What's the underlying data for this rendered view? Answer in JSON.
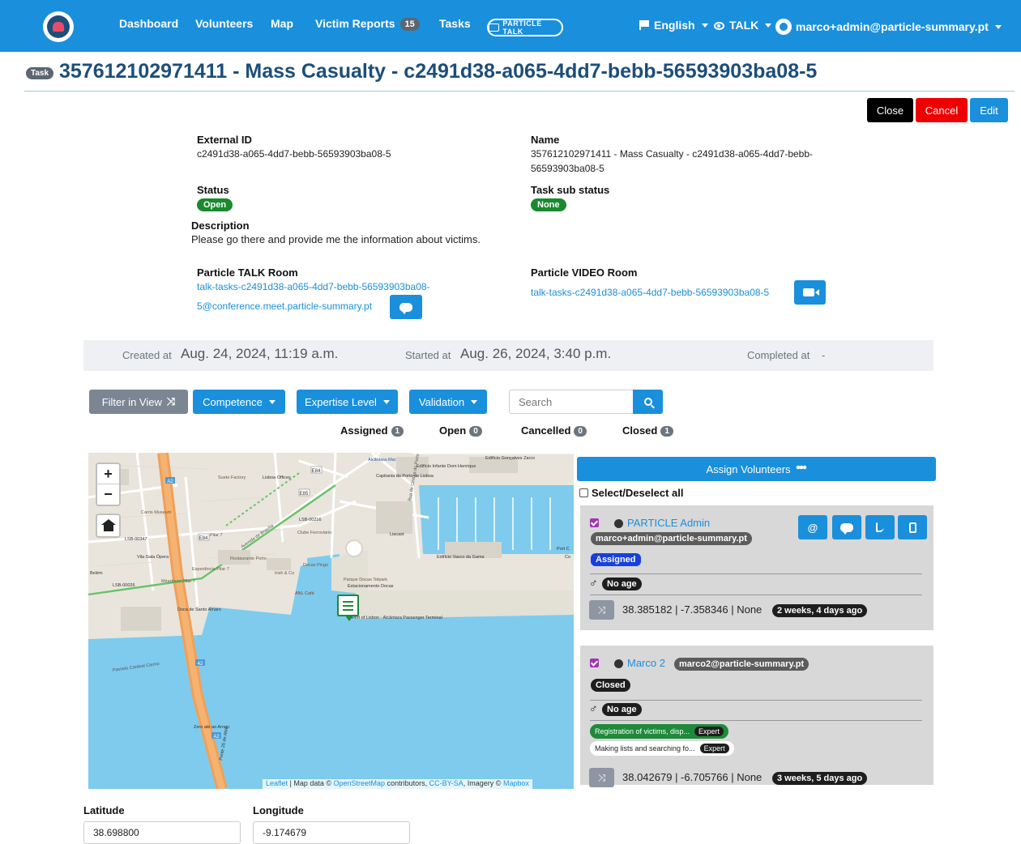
{
  "nav": {
    "items": [
      "Dashboard",
      "Volunteers",
      "Map",
      "Victim Reports",
      "Tasks"
    ],
    "victim_reports_count": "15",
    "brand_logo_text": "PARTICLE TALK",
    "language": "English",
    "talk": "TALK",
    "user_email": "marco+admin@particle-summary.pt"
  },
  "title": {
    "tag": "Task",
    "text": "357612102971411 - Mass Casualty - c2491d38-a065-4dd7-bebb-56593903ba08-5"
  },
  "actions": {
    "close": "Close",
    "cancel": "Cancel",
    "edit": "Edit"
  },
  "details": {
    "external_id_label": "External ID",
    "external_id": "c2491d38-a065-4dd7-bebb-56593903ba08-5",
    "name_label": "Name",
    "name_line1": "357612102971411 - Mass Casualty - c2491d38-a065-4dd7-bebb-",
    "name_line2": "56593903ba08-5",
    "status_label": "Status",
    "status": "Open",
    "substatus_label": "Task sub status",
    "substatus": "None",
    "description_label": "Description",
    "description": "Please go there and provide me the information about victims.",
    "talk_room_label": "Particle TALK Room",
    "talk_room_line1": "talk-tasks-c2491d38-a065-4dd7-bebb-56593903ba08-",
    "talk_room_line2": "5@conference.meet.particle-summary.pt",
    "video_room_label": "Particle VIDEO Room",
    "video_room": "talk-tasks-c2491d38-a065-4dd7-bebb-56593903ba08-5"
  },
  "dates": {
    "created_label": "Created at",
    "created": "Aug. 24, 2024, 11:19 a.m.",
    "started_label": "Started at",
    "started": "Aug. 26, 2024, 3:40 p.m.",
    "completed_label": "Completed at",
    "completed": "-"
  },
  "filters": {
    "filter_in_view": "Filter in View",
    "competence": "Competence",
    "expertise": "Expertise Level",
    "validation": "Validation",
    "search_placeholder": "Search"
  },
  "counts": {
    "assigned_label": "Assigned",
    "assigned": "1",
    "open_label": "Open",
    "open": "0",
    "cancelled_label": "Cancelled",
    "cancelled": "0",
    "closed_label": "Closed",
    "closed": "1"
  },
  "map": {
    "zoom_in": "+",
    "zoom_out": "−",
    "attribution_leaflet": "Leaflet",
    "attribution_mid": " | Map data © ",
    "attribution_osm": "OpenStreetMap",
    "attribution_contrib": " contributors, ",
    "attribution_cc": "CC-BY-SA",
    "attribution_imagery": ", Imagery © ",
    "attribution_mapbox": "Mapbox",
    "labels": [
      "Avenida de Brasília",
      "Clube Ferroviário",
      "Restaurante Porto",
      "Rua de Cintura do Porto de Lisboa",
      "Parque Docas Telpark",
      "Estacionamento Docas",
      "Edifício Vasco da Gama",
      "Port of Lisbon - Alcântara Passenger Terminal",
      "Passeio Cardeal Carmo",
      "Doca de Santo Amaro",
      "Pilar 7",
      "Experiência Pilar 7",
      "ANL Café",
      "Alcântara-Mar",
      "Ponte 25 de Abril",
      "Suete Factory",
      "Lisboa Offices",
      "Capitania do Porto de Lisboa",
      "Edifício Infante Dom Henrique",
      "Edifício Gonçalves Zarco",
      "Liacast",
      "Carris Museum",
      "LSB-00026",
      "LSB-00347",
      "LSB-00216",
      "Vila Gala Ópera",
      "Belém",
      "Irish & Co",
      "Docas Pingo",
      "Miradouro Pilar 7",
      "Zero até ao Arrojo",
      "Port C",
      "Co"
    ],
    "badges": [
      "E84",
      "E85",
      "E84",
      "42",
      "A2",
      "A2"
    ]
  },
  "panel": {
    "assign_label": "Assign Volunteers",
    "select_all": "Select/Deselect all",
    "volunteers": [
      {
        "name": "PARTICLE Admin",
        "email": "marco+admin@particle-summary.pt",
        "status": "Assigned",
        "gender_symbol": "♂",
        "age": "No age",
        "location": "38.385182 | -7.358346 | None",
        "ago": "2 weeks, 4 days ago"
      },
      {
        "name": "Marco 2",
        "email": "marco2@particle-summary.pt",
        "status": "Closed",
        "gender_symbol": "♂",
        "age": "No age",
        "competence1": "Registration of victims, disp...",
        "competence1_level": "Expert",
        "competence2": "Making lists and searching fo...",
        "competence2_level": "Expert",
        "location": "38.042679 | -6.705766 | None",
        "ago": "3 weeks, 5 days ago"
      }
    ],
    "contact_email_symbol": "@"
  },
  "coords": {
    "lat_label": "Latitude",
    "lat": "38.698800",
    "lng_label": "Longitude",
    "lng": "-9.174679"
  },
  "colors": {
    "navbar": "#1a8fdc",
    "title": "#1d4e7a",
    "open_badge": "#198a2e",
    "cancel": "#ee0000",
    "close": "#000000",
    "water": "#7ecbee",
    "road": "#f0a05a"
  }
}
